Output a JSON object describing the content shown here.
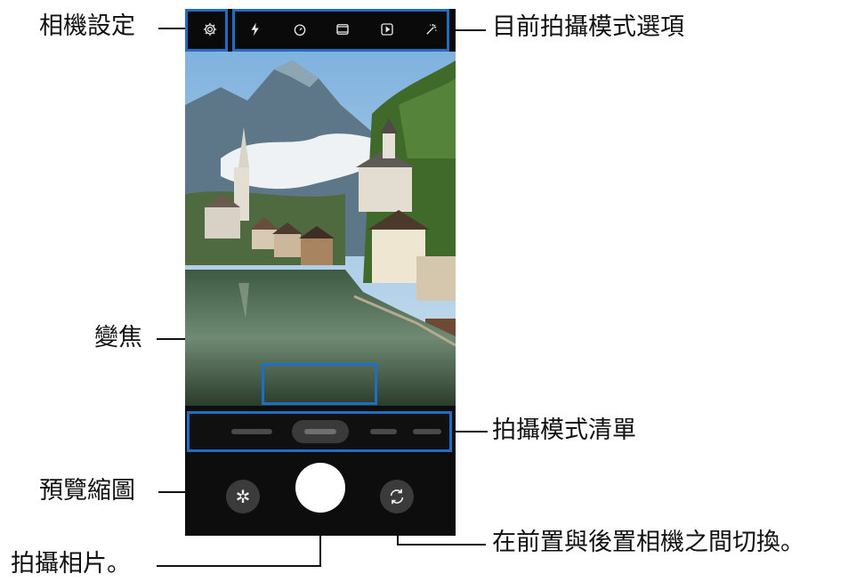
{
  "labels": {
    "camera_settings": "相機設定",
    "current_mode_options": "目前拍攝模式選項",
    "zoom": "變焦",
    "mode_list": "拍攝模式清單",
    "preview_thumbnail": "預覽縮圖",
    "take_photo": "拍攝相片。",
    "switch_camera": "在前置與後置相機之間切換。"
  },
  "icons": {
    "settings": "gear-icon",
    "flash": "flash-icon",
    "timer": "timer-icon",
    "ratio": "aspect-ratio-icon",
    "motion": "motion-photo-icon",
    "filter": "filter-icon",
    "preview": "✲",
    "switch": "switch-camera-icon"
  },
  "colors": {
    "highlight": "#1e6fc4",
    "phone": "#0d0d0d"
  }
}
